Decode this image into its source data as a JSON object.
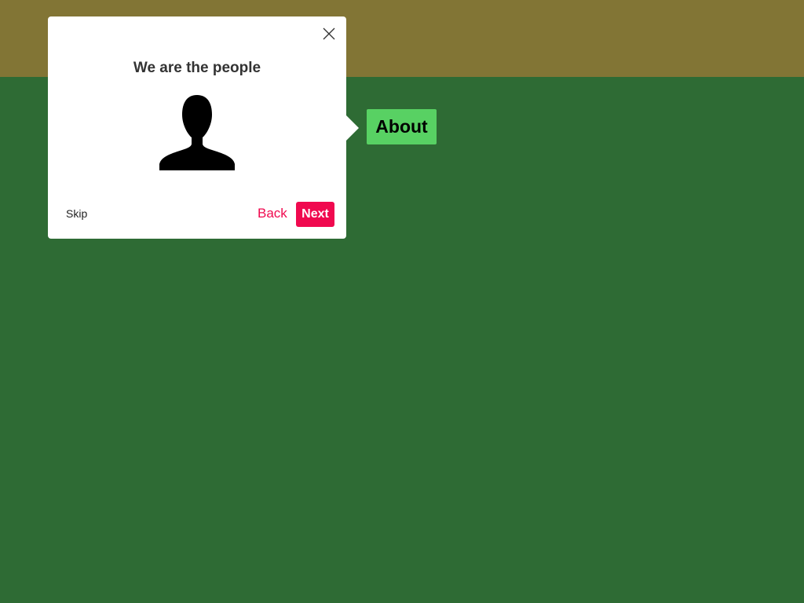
{
  "tour": {
    "title": "We are the people",
    "skip_label": "Skip",
    "back_label": "Back",
    "next_label": "Next",
    "illustration_icon": "user-silhouette-icon",
    "close_icon": "close-icon"
  },
  "target": {
    "label": "About"
  },
  "colors": {
    "page_background": "#2e6b34",
    "top_band": "#827535",
    "target_background": "#58d163",
    "accent": "#f0094f",
    "popover_background": "#ffffff"
  }
}
